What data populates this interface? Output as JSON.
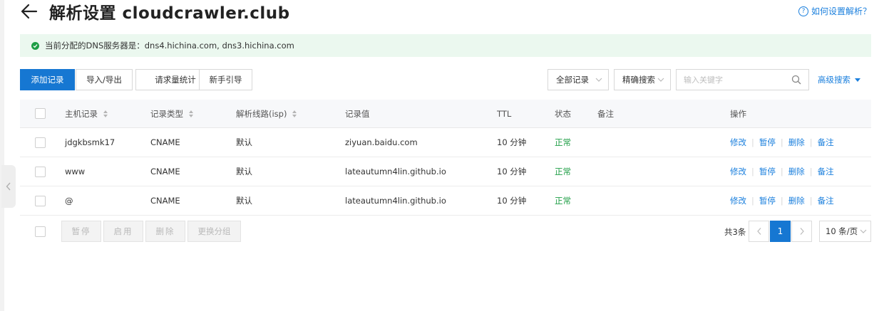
{
  "header": {
    "title": "解析设置 cloudcrawler.club",
    "help_link": "如何设置解析？"
  },
  "alert": {
    "text": "当前分配的DNS服务器是：dns4.hichina.com, dns3.hichina.com"
  },
  "toolbar": {
    "add_record": "添加记录",
    "import_export": "导入/导出",
    "request_stats": "请求量统计",
    "newbie_guide": "新手引导",
    "record_filter": "全部记录",
    "precise_search": "精确搜索",
    "search_placeholder": "输入关键字",
    "advanced_search": "高级搜索"
  },
  "table": {
    "columns": [
      "主机记录",
      "记录类型",
      "解析线路(isp)",
      "记录值",
      "TTL",
      "状态",
      "备注",
      "操作"
    ],
    "rows": [
      {
        "host": "jdgkbsmk17",
        "type": "CNAME",
        "line": "默认",
        "value": "ziyuan.baidu.com",
        "ttl": "10 分钟",
        "status": "正常",
        "remark": ""
      },
      {
        "host": "www",
        "type": "CNAME",
        "line": "默认",
        "value": "lateautumn4lin.github.io",
        "ttl": "10 分钟",
        "status": "正常",
        "remark": ""
      },
      {
        "host": "@",
        "type": "CNAME",
        "line": "默认",
        "value": "lateautumn4lin.github.io",
        "ttl": "10 分钟",
        "status": "正常",
        "remark": ""
      }
    ],
    "actions": {
      "edit": "修改",
      "pause": "暂停",
      "delete": "删除",
      "remark": "备注"
    }
  },
  "footer": {
    "pause": "暂停",
    "enable": "启用",
    "delete": "删除",
    "change_group": "更换分组",
    "total": "共3条",
    "current_page": "1",
    "page_size": "10 条/页"
  },
  "colors": {
    "accent": "#1677d2",
    "link": "#1a7fdd",
    "success": "#1f9e46",
    "alert_bg": "#ebf8ef"
  }
}
